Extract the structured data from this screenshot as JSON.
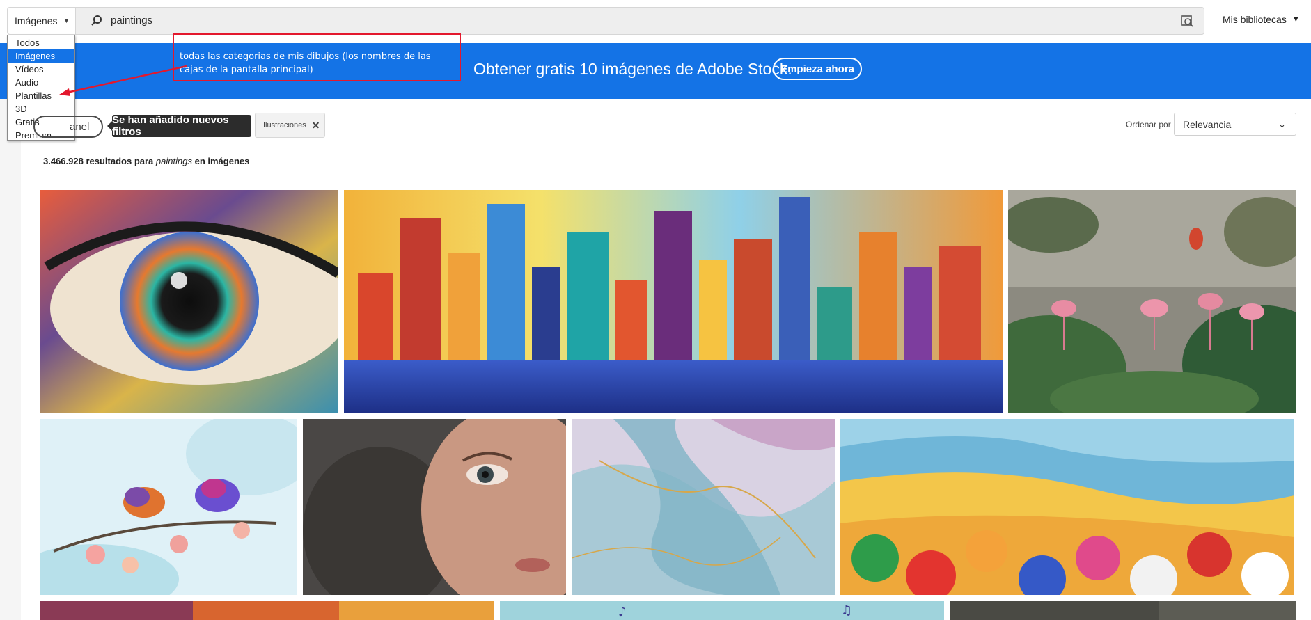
{
  "search": {
    "type_selected": "Imágenes",
    "query": "paintings",
    "libraries_label": "Mis bibliotecas"
  },
  "dropdown": {
    "items": [
      "Todos",
      "Imágenes",
      "Vídeos",
      "Audio",
      "Plantillas",
      "3D",
      "Gratis",
      "Premium"
    ],
    "selected": "Imágenes"
  },
  "annotation": {
    "note": "todas las categorias de mis dibujos (los nombres de las cajas de la pantalla principal)",
    "color": "#e3182d"
  },
  "banner": {
    "text": "Obtener gratis 10 imágenes de Adobe Stock.",
    "button": "Empieza ahora",
    "color": "#1473e6"
  },
  "filters": {
    "panel_label": "anel",
    "tooltip": "Se han añadido nuevos filtros",
    "chip_label": "Ilustraciones",
    "sort_label": "Ordenar por",
    "sort_value": "Relevancia"
  },
  "results": {
    "count": "3.466.928",
    "mid": "resultados para",
    "query": "paintings",
    "suffix": "en imágenes"
  },
  "images": [
    "eye-painting",
    "city-skyline-painting",
    "flamingo-jungle-painting",
    "birds-painting",
    "woman-face-painting",
    "alcohol-ink-painting",
    "beach-umbrellas-painting",
    "sunset-painting",
    "music-notes-painting",
    "dark-painting"
  ]
}
